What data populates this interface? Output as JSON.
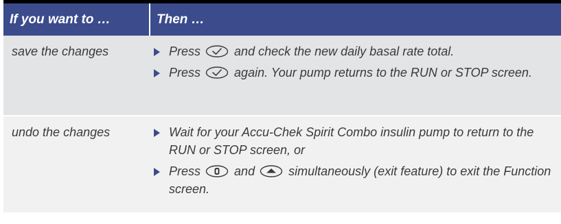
{
  "header": {
    "col1": "If you want to …",
    "col2": "Then …"
  },
  "rows": [
    {
      "want": "save the changes",
      "steps": [
        {
          "before": "Press",
          "icon": "ok-check-button-icon",
          "after": "and check the new daily basal rate total."
        },
        {
          "before": "Press",
          "icon": "ok-check-button-icon",
          "after": "again. Your pump returns to the RUN or STOP screen."
        }
      ]
    },
    {
      "want": "undo the changes",
      "steps": [
        {
          "text": "Wait for your Accu-Chek Spirit Combo insulin pump to return to the RUN or STOP screen, or"
        },
        {
          "before": "Press",
          "icon": "menu-key-icon",
          "middle": "and",
          "icon2": "up-arrow-key-icon",
          "after": "simultaneously (exit feature) to exit the Function screen."
        }
      ]
    }
  ],
  "colors": {
    "header_bg": "#3b4b8c",
    "row1_bg": "#e3e4e6",
    "row2_bg": "#f1f1f2",
    "bullet": "#3b4b8c"
  }
}
